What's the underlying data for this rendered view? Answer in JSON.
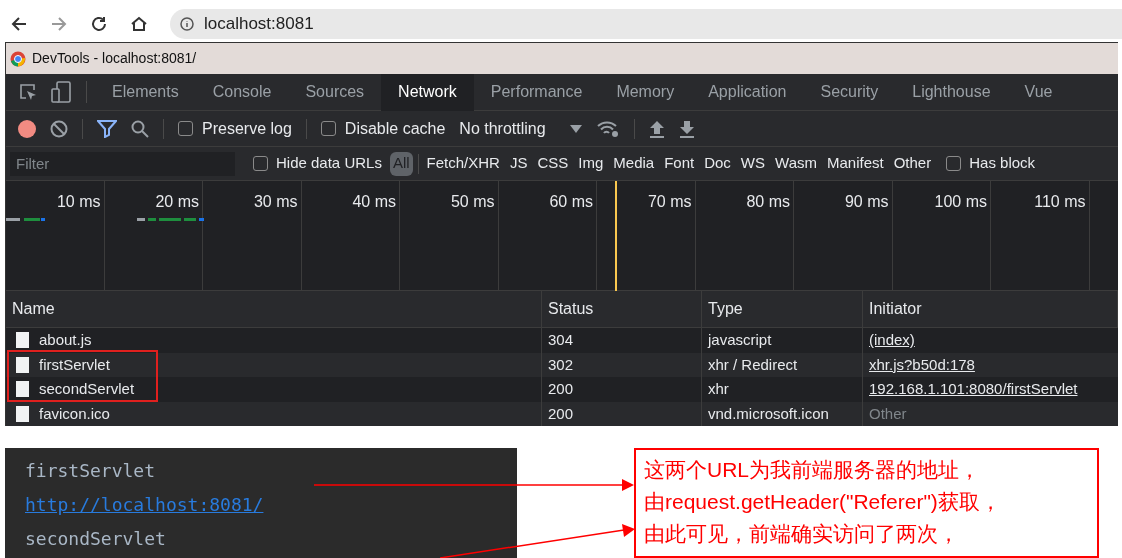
{
  "browser": {
    "address": "localhost:8081"
  },
  "devtools": {
    "title": "DevTools - localhost:8081/",
    "tabs": [
      {
        "label": "Elements",
        "selected": false
      },
      {
        "label": "Console",
        "selected": false
      },
      {
        "label": "Sources",
        "selected": false
      },
      {
        "label": "Network",
        "selected": true
      },
      {
        "label": "Performance",
        "selected": false
      },
      {
        "label": "Memory",
        "selected": false
      },
      {
        "label": "Application",
        "selected": false
      },
      {
        "label": "Security",
        "selected": false
      },
      {
        "label": "Lighthouse",
        "selected": false
      },
      {
        "label": "Vue",
        "selected": false
      }
    ],
    "toolbar": {
      "preserve_log": {
        "label": "Preserve log",
        "checked": false
      },
      "disable_cache": {
        "label": "Disable cache",
        "checked": false
      },
      "throttling": "No throttling"
    },
    "filter": {
      "placeholder": "Filter",
      "hide_data_urls": {
        "label": "Hide data URLs",
        "checked": false
      },
      "types": [
        {
          "label": "All",
          "selected": true
        },
        {
          "label": "Fetch/XHR",
          "selected": false
        },
        {
          "label": "JS",
          "selected": false
        },
        {
          "label": "CSS",
          "selected": false
        },
        {
          "label": "Img",
          "selected": false
        },
        {
          "label": "Media",
          "selected": false
        },
        {
          "label": "Font",
          "selected": false
        },
        {
          "label": "Doc",
          "selected": false
        },
        {
          "label": "WS",
          "selected": false
        },
        {
          "label": "Wasm",
          "selected": false
        },
        {
          "label": "Manifest",
          "selected": false
        },
        {
          "label": "Other",
          "selected": false
        }
      ],
      "has_blocked": {
        "label": "Has block",
        "checked": false
      }
    },
    "timeline": [
      "10 ms",
      "20 ms",
      "30 ms",
      "40 ms",
      "50 ms",
      "60 ms",
      "70 ms",
      "80 ms",
      "90 ms",
      "100 ms",
      "110 ms"
    ],
    "table": {
      "columns": [
        "Name",
        "Status",
        "Type",
        "Initiator"
      ],
      "rows": [
        {
          "name": "about.js",
          "status": "304",
          "type": "javascript",
          "initiator": "(index)",
          "underlined": true
        },
        {
          "name": "firstServlet",
          "status": "302",
          "type": "xhr / Redirect",
          "initiator": "xhr.js?b50d:178",
          "underlined": true
        },
        {
          "name": "secondServlet",
          "status": "200",
          "type": "xhr",
          "initiator": "192.168.1.101:8080/firstServlet",
          "underlined": true
        },
        {
          "name": "favicon.ico",
          "status": "200",
          "type": "vnd.microsoft.icon",
          "initiator": "Other",
          "underlined": false
        }
      ]
    }
  },
  "console": [
    {
      "text": "firstServlet",
      "kind": "text"
    },
    {
      "text": "http://localhost:8081/",
      "kind": "link"
    },
    {
      "text": "secondServlet",
      "kind": "text"
    }
  ],
  "annotation": [
    "这两个URL为我前端服务器的地址，",
    "由request.getHeader(\"Referer\")获取，",
    "由此可见，前端确实访问了两次，"
  ]
}
